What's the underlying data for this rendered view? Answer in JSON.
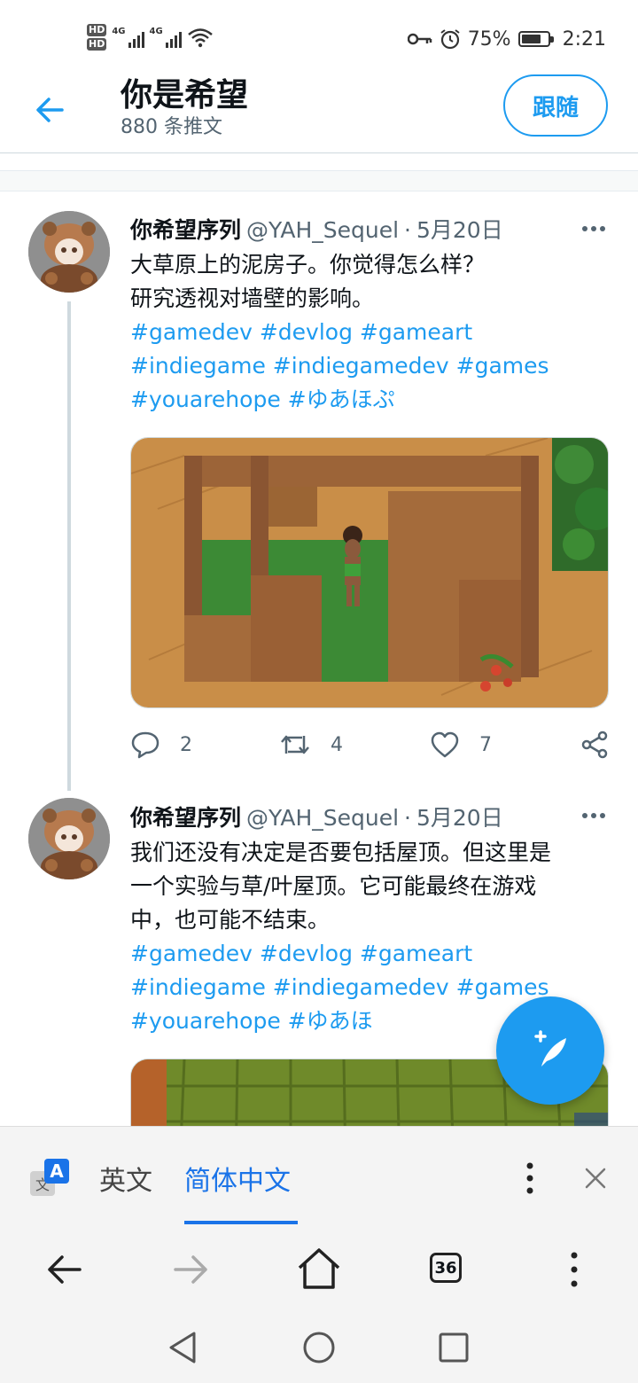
{
  "status": {
    "hd1": "HD",
    "hd2": "HD",
    "net1": "4G",
    "net2": "4G",
    "battery_percent": "75%",
    "battery_level": 0.75,
    "time": "2:21"
  },
  "header": {
    "name": "你是希望",
    "tweet_count": "880 条推文",
    "follow_label": "跟随"
  },
  "tweets": [
    {
      "author": "你希望序列",
      "handle": "@YAH_Sequel",
      "separator": "·",
      "date": "5月20日",
      "text_lines": [
        "大草原上的泥房子。你觉得怎么样？",
        "研究透视对墙壁的影响。"
      ],
      "hashtags": "#gamedev #devlog #gameart #indiegame #indiegamedev #games #youarehope #ゆあほぷ",
      "media": "isometric-mud-house-image",
      "replies": "2",
      "retweets": "4",
      "likes": "7"
    },
    {
      "author": "你希望序列",
      "handle": "@YAH_Sequel",
      "separator": "·",
      "date": "5月20日",
      "text_lines": [
        "我们还没有决定是否要包括屋顶。但这里是",
        "一个实验与草/叶屋顶。它可能最终在游戏",
        "中，也可能不结束。"
      ],
      "hashtags": "#gamedev #devlog #gameart #indiegame #indiegamedev #games #youarehope #ゆあほ",
      "media": "thatched-roof-image"
    }
  ],
  "translate": {
    "source_lang": "英文",
    "target_lang": "简体中文",
    "translate_icon_letter": "A",
    "translate_icon_small": "文"
  },
  "browser": {
    "tab_count": "36"
  },
  "colors": {
    "accent": "#1d9bf0",
    "text": "#0f1419",
    "muted": "#536471",
    "translate_accent": "#1a73e8"
  }
}
